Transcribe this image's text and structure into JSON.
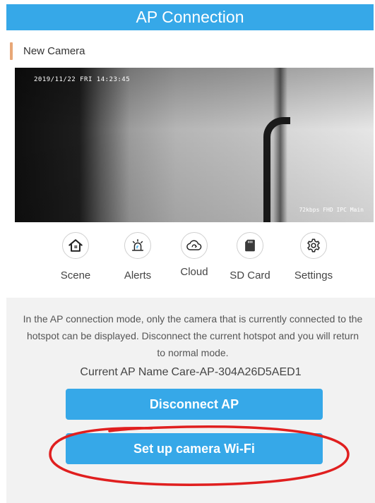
{
  "header": {
    "title": "AP Connection"
  },
  "device": {
    "name": "New Camera"
  },
  "video": {
    "timestamp": "2019/11/22  FRI 14:23:45",
    "status": "72kbps FHD IPC Main"
  },
  "toolbar": {
    "items": [
      {
        "label": "Scene",
        "icon": "home-icon"
      },
      {
        "label": "Alerts",
        "icon": "alarm-icon"
      },
      {
        "label": "Cloud",
        "icon": "cloud-icon"
      },
      {
        "label": "SD Card",
        "icon": "sd-card-icon"
      },
      {
        "label": "Settings",
        "icon": "gear-icon"
      }
    ]
  },
  "ap_panel": {
    "info": "In the AP connection mode, only the camera that is currently connected to the hotspot can be displayed. Disconnect the current hotspot and you will return to normal mode.",
    "ap_label": "Current AP Name",
    "ap_value": "Care-AP-304A26D5AED1",
    "disconnect_label": "Disconnect AP",
    "wifi_setup_label": "Set up camera Wi-Fi"
  },
  "colors": {
    "accent": "#36a8e8",
    "annotation": "#e01f1f",
    "section_marker": "#e8a777"
  }
}
